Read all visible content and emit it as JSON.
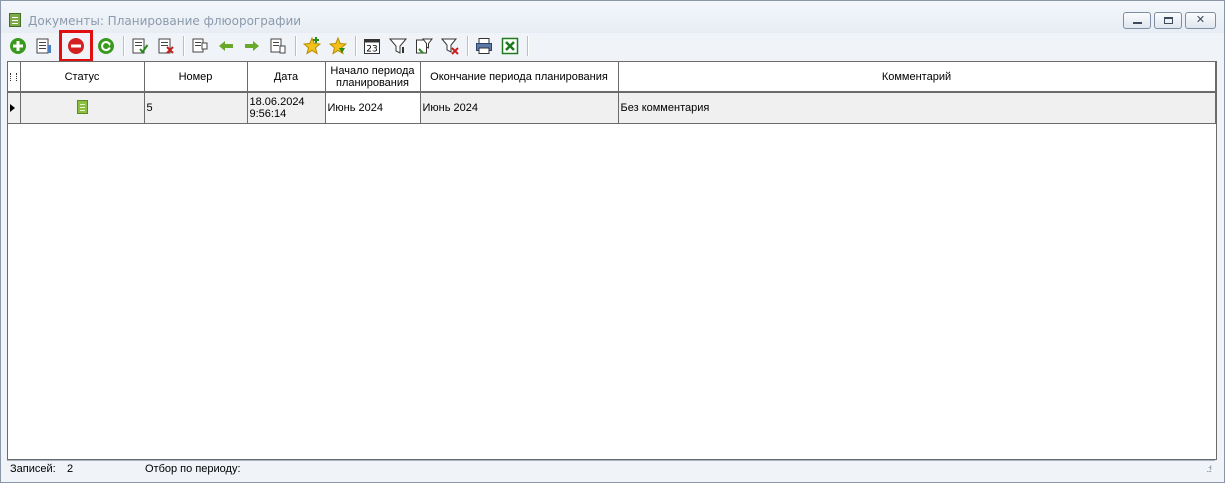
{
  "window": {
    "title": "Документы: Планирование флюорографии"
  },
  "toolbar": {
    "buttons": [
      {
        "icon": "add-icon"
      },
      {
        "icon": "edit-document-icon"
      },
      {
        "icon": "delete-icon",
        "highlighted": true
      },
      {
        "icon": "refresh-icon"
      },
      {
        "icon": "post-document-icon"
      },
      {
        "icon": "unpost-document-icon"
      },
      {
        "icon": "copy-icon"
      },
      {
        "icon": "arrow-left-icon"
      },
      {
        "icon": "arrow-right-icon"
      },
      {
        "icon": "structure-icon"
      },
      {
        "icon": "favorite-add-icon"
      },
      {
        "icon": "favorite-icon"
      },
      {
        "icon": "calendar-icon"
      },
      {
        "icon": "filter-icon"
      },
      {
        "icon": "filter-edit-icon"
      },
      {
        "icon": "filter-clear-icon"
      },
      {
        "icon": "print-icon"
      },
      {
        "icon": "excel-icon"
      }
    ],
    "calendar_day": "23"
  },
  "table": {
    "columns": [
      "Статус",
      "Номер",
      "Дата",
      "Начало периода\nпланирования",
      "Окончание периода планирования",
      "Комментарий"
    ],
    "rows": [
      {
        "status": "status-document-icon",
        "number": "5",
        "date_line1": "18.06.2024",
        "date_line2": "9:56:14",
        "start": "Июнь 2024",
        "end": "Июнь 2024",
        "comment": "Без комментария"
      }
    ]
  },
  "statusbar": {
    "records_label": "Записей:",
    "records_value": "2",
    "period_label": "Отбор по периоду:"
  },
  "colors": {
    "highlight": "#e01010",
    "green_icon": "#3a9a1e",
    "red_icon": "#d42020"
  }
}
